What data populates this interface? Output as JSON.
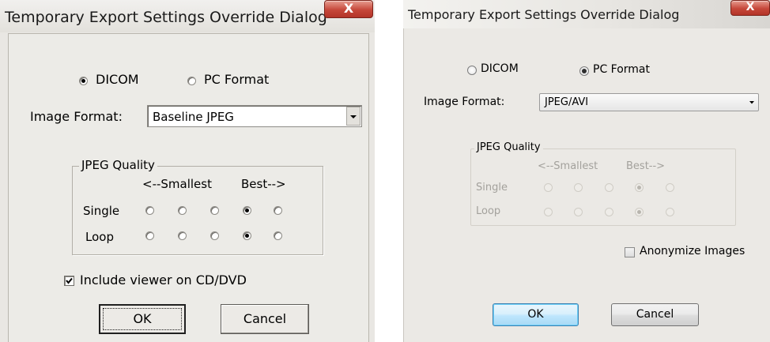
{
  "left": {
    "title": "Temporary Export Settings Override Dialog",
    "close_glyph": "X",
    "format_options": [
      {
        "label": "DICOM",
        "selected": true
      },
      {
        "label": "PC Format",
        "selected": false
      }
    ],
    "image_format_label": "Image Format:",
    "image_format_value": "Baseline JPEG",
    "jpeg_quality": {
      "title": "JPEG Quality",
      "smallest": "<--Smallest",
      "best": "Best-->",
      "rows": [
        {
          "label": "Single",
          "selected_index": 3
        },
        {
          "label": "Loop",
          "selected_index": 3
        }
      ]
    },
    "include_viewer": {
      "label": "Include viewer on CD/DVD",
      "checked": true
    },
    "ok_label": "OK",
    "cancel_label": "Cancel"
  },
  "right": {
    "title": "Temporary Export Settings Override Dialog",
    "close_glyph": "X",
    "format_options": [
      {
        "label": "DICOM",
        "selected": false
      },
      {
        "label": "PC Format",
        "selected": true
      }
    ],
    "image_format_label": "Image Format:",
    "image_format_value": "JPEG/AVI",
    "jpeg_quality": {
      "title": "JPEG Quality",
      "smallest": "<--Smallest",
      "best": "Best-->",
      "rows": [
        {
          "label": "Single",
          "selected_index": 3
        },
        {
          "label": "Loop",
          "selected_index": 3
        }
      ]
    },
    "anonymize": {
      "label": "Anonymize Images",
      "checked": false
    },
    "ok_label": "OK",
    "cancel_label": "Cancel"
  }
}
